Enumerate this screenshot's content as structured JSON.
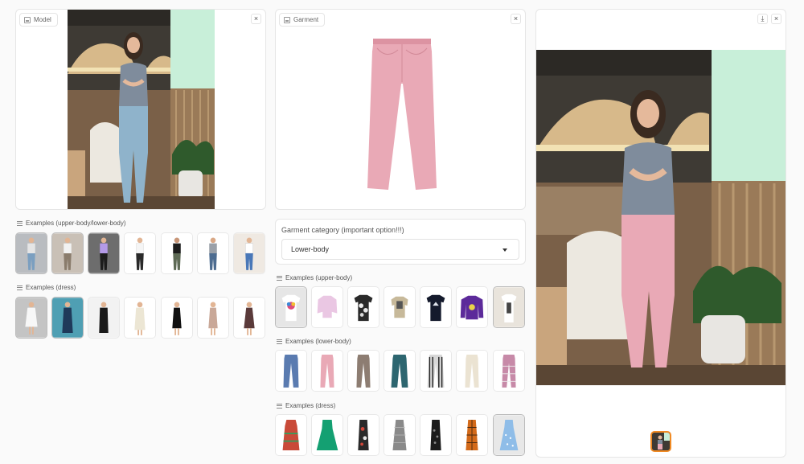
{
  "model_panel": {
    "label": "Model",
    "close_icon": "×"
  },
  "garment_panel": {
    "label": "Garment",
    "close_icon": "×"
  },
  "result_panel": {
    "download_icon": "⤓",
    "close_icon": "×"
  },
  "model_examples": {
    "upper_lower_label": "Examples (upper-body/lower-body)",
    "dress_label": "Examples (dress)"
  },
  "garment_category": {
    "label": "Garment category (important option!!!)",
    "selected": "Lower-body"
  },
  "garment_examples": {
    "upper_label": "Examples (upper-body)",
    "lower_label": "Examples (lower-body)",
    "dress_label": "Examples (dress)"
  },
  "colors": {
    "screen": "#c8efd9",
    "wall": "#3e3a34",
    "jeans_blue": "#8fb3cb",
    "pants_pink": "#e9a9b6",
    "shirt_grey": "#7f8c9c"
  }
}
